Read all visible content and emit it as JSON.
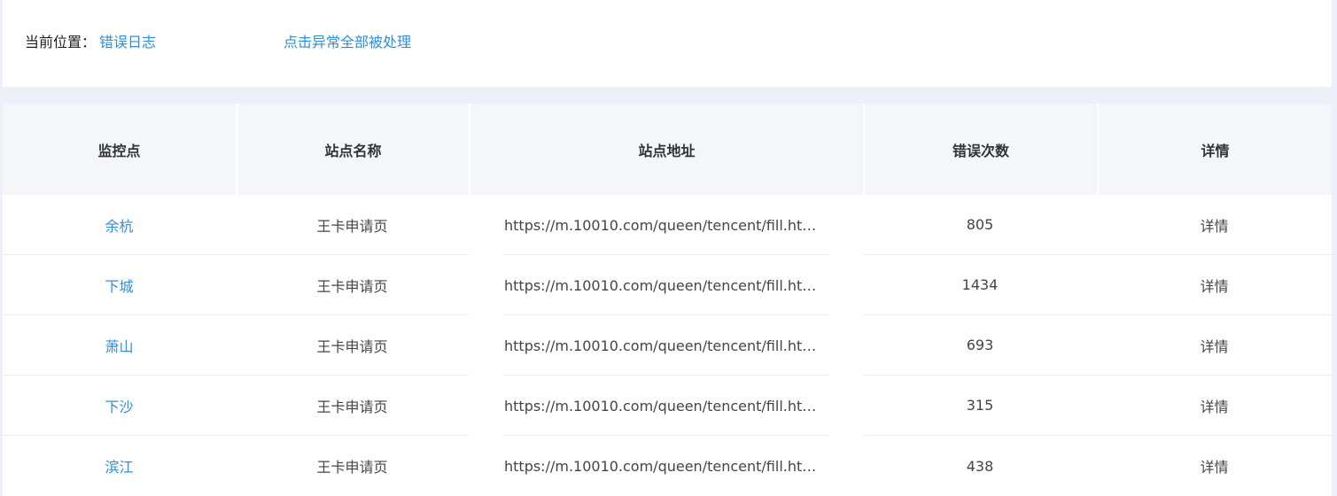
{
  "breadcrumb": {
    "label": "当前位置：",
    "current": "错误日志"
  },
  "action_link": "点击异常全部被处理",
  "table": {
    "headers": [
      "监控点",
      "站点名称",
      "站点地址",
      "错误次数",
      "详情"
    ],
    "rows": [
      {
        "point": "余杭",
        "site_name": "王卡申请页",
        "url": "https://m.10010.com/queen/tencent/fill.html?...",
        "errors": "805",
        "detail": "详情"
      },
      {
        "point": "下城",
        "site_name": "王卡申请页",
        "url": "https://m.10010.com/queen/tencent/fill.html?...",
        "errors": "1434",
        "detail": "详情"
      },
      {
        "point": "萧山",
        "site_name": "王卡申请页",
        "url": "https://m.10010.com/queen/tencent/fill.html?...",
        "errors": "693",
        "detail": "详情"
      },
      {
        "point": "下沙",
        "site_name": "王卡申请页",
        "url": "https://m.10010.com/queen/tencent/fill.html?...",
        "errors": "315",
        "detail": "详情"
      },
      {
        "point": "滨江",
        "site_name": "王卡申请页",
        "url": "https://m.10010.com/queen/tencent/fill.html?...",
        "errors": "438",
        "detail": "详情"
      }
    ]
  },
  "colors": {
    "link": "#2f8fd8",
    "header_bg": "#f5f6fa",
    "page_bg": "#edf0f8"
  }
}
